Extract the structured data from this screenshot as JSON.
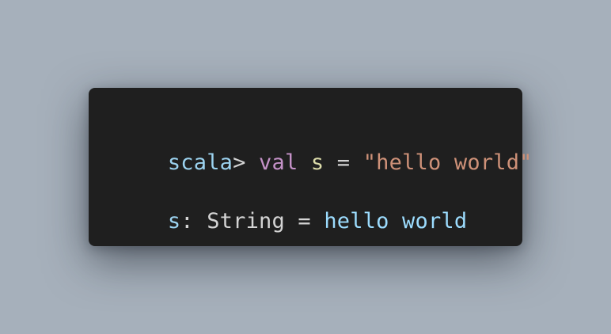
{
  "theme": {
    "background": "#a6b0bb",
    "terminal_background": "#1f1f1f",
    "colors": {
      "prompt": "#9cd3f0",
      "plain": "#d4d4d4",
      "keyword": "#c592c8",
      "identifier": "#dcdcaa",
      "string": "#ce9178",
      "result_value": "#9cdcfe"
    }
  },
  "terminal": {
    "lines": [
      {
        "tokens": [
          {
            "text": "scala",
            "style": "prompt"
          },
          {
            "text": "> ",
            "style": "plain"
          },
          {
            "text": "val",
            "style": "keyword"
          },
          {
            "text": " ",
            "style": "plain"
          },
          {
            "text": "s",
            "style": "identifier"
          },
          {
            "text": " = ",
            "style": "plain"
          },
          {
            "text": "\"hello world\"",
            "style": "string"
          }
        ]
      },
      {
        "tokens": [
          {
            "text": "s",
            "style": "prompt"
          },
          {
            "text": ": String = ",
            "style": "plain"
          },
          {
            "text": "hello world",
            "style": "result_value"
          }
        ]
      }
    ]
  }
}
